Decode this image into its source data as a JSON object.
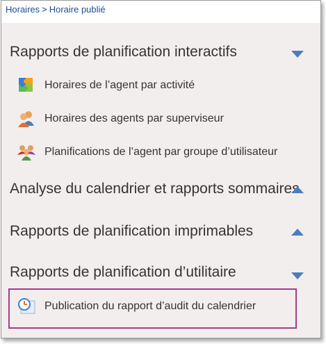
{
  "breadcrumb": {
    "items": [
      "Horaires",
      "Horaire publié"
    ],
    "separator": ">"
  },
  "sections": [
    {
      "title": "Rapports de planification interactifs",
      "state": "expanded",
      "items": [
        {
          "label": "Horaires de l’agent par activité",
          "icon": "puzzle-icon"
        },
        {
          "label": "Horaires des agents par superviseur",
          "icon": "supervisor-group-icon"
        },
        {
          "label": "Planifications de l’agent par groupe d’utilisateur",
          "icon": "user-group-icon"
        }
      ]
    },
    {
      "title": "Analyse du calendrier et rapports sommaires",
      "state": "collapsed",
      "items": []
    },
    {
      "title": "Rapports de planification imprimables",
      "state": "collapsed",
      "items": []
    },
    {
      "title": "Rapports de planification d’utilitaire",
      "state": "expanded",
      "items": [
        {
          "label": "Publication du rapport d’audit du calendrier",
          "icon": "clock-report-icon",
          "highlighted": true
        }
      ]
    }
  ],
  "colors": {
    "panel_bg": "#f3eeee",
    "accent_arrow": "#4a7fbd",
    "highlight_border": "#a63a8b",
    "breadcrumb_link": "#1d4f91"
  }
}
